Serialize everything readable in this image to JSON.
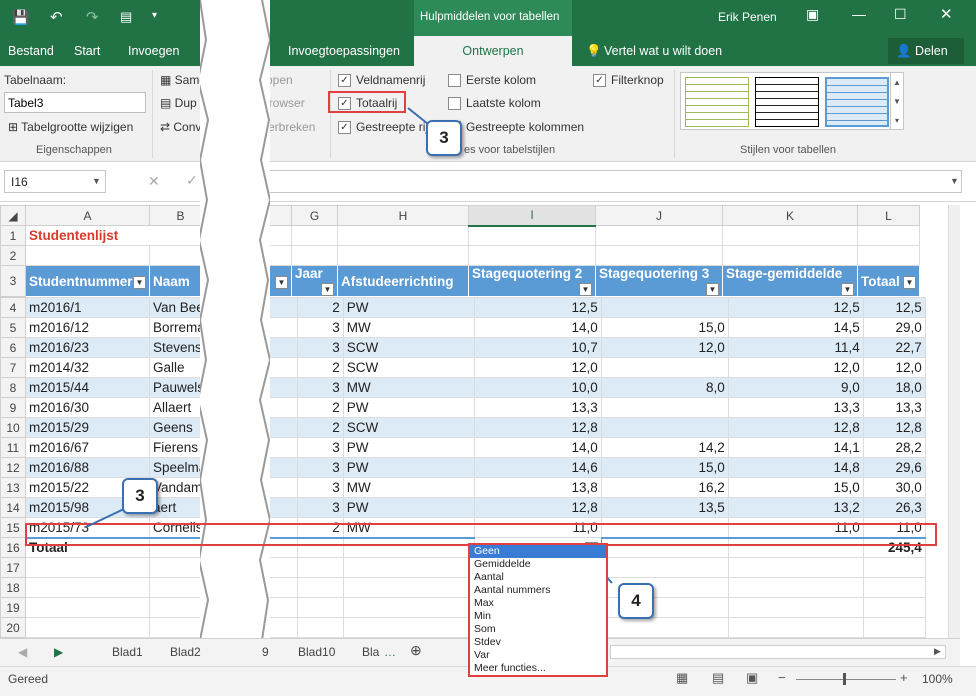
{
  "window": {
    "context_title": "Hulpmiddelen voor tabellen",
    "user": "Erik Penen",
    "share": "Delen",
    "tell_me": "Vertel wat u wilt doen"
  },
  "ribbon_tabs": [
    "Bestand",
    "Start",
    "Invoegen",
    "Pa",
    "Invoegtoepassingen",
    "Ontwerpen"
  ],
  "ribbon": {
    "tablename_label": "Tabelnaam:",
    "tablename_value": "Tabel3",
    "resize": "Tabelgrootte wijzigen",
    "group_properties": "Eigenschappen",
    "tools": [
      "Samen",
      "ppen",
      "Dup",
      "n browser",
      "Conve",
      "verbreken"
    ],
    "options": {
      "veldnamenrij": "Veldnamenrij",
      "eerste_kolom": "Eerste kolom",
      "filterknop": "Filterknop",
      "totaalrij": "Totaalrij",
      "laatste_kolom": "Laatste kolom",
      "gestreepte_rijen": "Gestreepte rij",
      "gestreepte_kolommen": "Gestreepte kolommen",
      "group": "es voor tabelstijlen"
    },
    "styles_group": "Stijlen voor tabellen"
  },
  "formula": {
    "namebox": "I16",
    "cancel": "✕",
    "enter": "✓"
  },
  "columns": [
    "A",
    "B",
    "G",
    "H",
    "I",
    "J",
    "K",
    "L"
  ],
  "sheet": {
    "row1_title": "Studentenlijst",
    "headers": [
      "Studentnummer",
      "Naam",
      "Jaar",
      "Afstudeerrichting",
      "Stagequotering 2",
      "Stagequotering 3",
      "Stage-gemiddelde",
      "Totaal"
    ],
    "rows": [
      [
        "m2016/1",
        "Van Beek",
        "2",
        "PW",
        "12,5",
        "",
        "12,5",
        "12,5"
      ],
      [
        "m2016/12",
        "Borreman",
        "3",
        "MW",
        "14,0",
        "15,0",
        "14,5",
        "29,0"
      ],
      [
        "m2016/23",
        "Stevens",
        "3",
        "SCW",
        "10,7",
        "12,0",
        "11,4",
        "22,7"
      ],
      [
        "m2014/32",
        "Galle",
        "2",
        "SCW",
        "12,0",
        "",
        "12,0",
        "12,0"
      ],
      [
        "m2015/44",
        "Pauwels",
        "3",
        "MW",
        "10,0",
        "8,0",
        "9,0",
        "18,0"
      ],
      [
        "m2016/30",
        "Allaert",
        "2",
        "PW",
        "13,3",
        "",
        "13,3",
        "13,3"
      ],
      [
        "m2015/29",
        "Geens",
        "2",
        "SCW",
        "12,8",
        "",
        "12,8",
        "12,8"
      ],
      [
        "m2016/67",
        "Fierens",
        "3",
        "PW",
        "14,0",
        "14,2",
        "14,1",
        "28,2"
      ],
      [
        "m2016/88",
        "Speelman",
        "3",
        "PW",
        "14,6",
        "15,0",
        "14,8",
        "29,6"
      ],
      [
        "m2015/22",
        "Vandam",
        "3",
        "MW",
        "13,8",
        "16,2",
        "15,0",
        "30,0"
      ],
      [
        "m2015/98",
        "aert",
        "3",
        "PW",
        "12,8",
        "13,5",
        "13,2",
        "26,3"
      ],
      [
        "m2015/73",
        "Cornelis",
        "2",
        "MW",
        "11,0",
        "",
        "11,0",
        "11,0"
      ]
    ],
    "total_label": "Totaal",
    "total_value": "245,4"
  },
  "dropdown": [
    "Geen",
    "Gemiddelde",
    "Aantal",
    "Aantal nummers",
    "Max",
    "Min",
    "Som",
    "Stdev",
    "Var",
    "Meer functies..."
  ],
  "sheet_tabs": [
    "Blad1",
    "Blad2",
    "9",
    "Blad10",
    "Bla"
  ],
  "status": {
    "ready": "Gereed",
    "zoom": "100%"
  },
  "callouts": [
    "3",
    "3",
    "4"
  ]
}
